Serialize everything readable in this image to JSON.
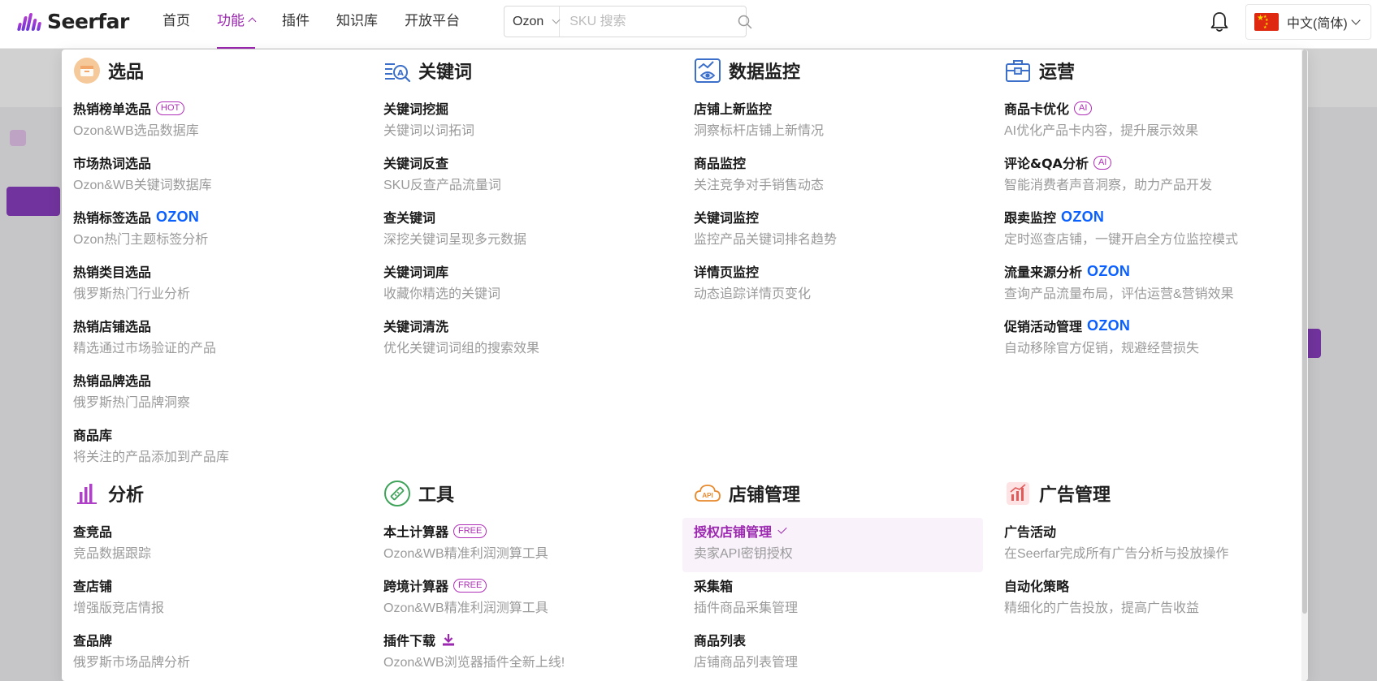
{
  "brand": {
    "name": "Seerfar"
  },
  "nav": {
    "items": [
      {
        "label": "首页",
        "active": false
      },
      {
        "label": "功能",
        "active": true
      },
      {
        "label": "插件",
        "active": false
      },
      {
        "label": "知识库",
        "active": false
      },
      {
        "label": "开放平台",
        "active": false
      }
    ]
  },
  "search": {
    "platform": "Ozon",
    "placeholder": "SKU 搜索"
  },
  "language": {
    "label": "中文(简体)"
  },
  "colors": {
    "accent": "#9c27b0",
    "ozon": "#0a5fff",
    "badge": "#b02fb8"
  },
  "menu": {
    "selection": {
      "title": "选品",
      "icon": "product-box-icon",
      "items": [
        {
          "title": "热销榜单选品",
          "badge": "HOT",
          "desc": "Ozon&WB选品数据库"
        },
        {
          "title": "市场热词选品",
          "desc": "Ozon&WB关键词数据库"
        },
        {
          "title": "热销标签选品",
          "tag": "OZON",
          "desc": "Ozon热门主题标签分析"
        },
        {
          "title": "热销类目选品",
          "desc": "俄罗斯热门行业分析"
        },
        {
          "title": "热销店铺选品",
          "desc": "精选通过市场验证的产品"
        },
        {
          "title": "热销品牌选品",
          "desc": "俄罗斯热门品牌洞察"
        },
        {
          "title": "商品库",
          "desc": "将关注的产品添加到产品库"
        }
      ]
    },
    "keywords": {
      "title": "关键词",
      "icon": "keyword-search-icon",
      "items": [
        {
          "title": "关键词挖掘",
          "desc": "关键词以词拓词"
        },
        {
          "title": "关键词反查",
          "desc": "SKU反查产品流量词"
        },
        {
          "title": "查关键词",
          "desc": "深挖关键词呈现多元数据"
        },
        {
          "title": "关键词词库",
          "desc": "收藏你精选的关键词"
        },
        {
          "title": "关键词清洗",
          "desc": "优化关键词词组的搜索效果"
        }
      ]
    },
    "monitoring": {
      "title": "数据监控",
      "icon": "monitor-eye-icon",
      "items": [
        {
          "title": "店铺上新监控",
          "desc": "洞察标杆店铺上新情况"
        },
        {
          "title": "商品监控",
          "desc": "关注竞争对手销售动态"
        },
        {
          "title": "关键词监控",
          "desc": "监控产品关键词排名趋势"
        },
        {
          "title": "详情页监控",
          "desc": "动态追踪详情页变化"
        }
      ]
    },
    "operations": {
      "title": "运营",
      "icon": "toolbox-icon",
      "items": [
        {
          "title": "商品卡优化",
          "badge": "AI",
          "desc": "AI优化产品卡内容，提升展示效果"
        },
        {
          "title": "评论&QA分析",
          "badge": "AI",
          "desc": "智能消费者声音洞察，助力产品开发"
        },
        {
          "title": "跟卖监控",
          "tag": "OZON",
          "desc": "定时巡查店铺，一键开启全方位监控模式"
        },
        {
          "title": "流量来源分析",
          "tag": "OZON",
          "desc": "查询产品流量布局，评估运营&营销效果"
        },
        {
          "title": "促销活动管理",
          "tag": "OZON",
          "desc": "自动移除官方促销，规避经营损失"
        }
      ]
    },
    "analysis": {
      "title": "分析",
      "icon": "bar-chart-icon",
      "items": [
        {
          "title": "查竞品",
          "desc": "竞品数据跟踪"
        },
        {
          "title": "查店铺",
          "desc": "增强版竞店情报"
        },
        {
          "title": "查品牌",
          "desc": "俄罗斯市场品牌分析"
        }
      ]
    },
    "tools": {
      "title": "工具",
      "icon": "ruler-tool-icon",
      "items": [
        {
          "title": "本土计算器",
          "badge": "FREE",
          "desc": "Ozon&WB精准利润测算工具"
        },
        {
          "title": "跨境计算器",
          "badge": "FREE",
          "desc": "Ozon&WB精准利润测算工具"
        },
        {
          "title": "插件下载",
          "desc": "Ozon&WB浏览器插件全新上线!"
        }
      ]
    },
    "store": {
      "title": "店铺管理",
      "icon": "api-cloud-icon",
      "items": [
        {
          "title": "授权店铺管理",
          "desc": "卖家API密钥授权",
          "selected": true
        },
        {
          "title": "采集箱",
          "desc": "插件商品采集管理"
        },
        {
          "title": "商品列表",
          "desc": "店铺商品列表管理"
        }
      ]
    },
    "ads": {
      "title": "广告管理",
      "icon": "ad-chart-icon",
      "items": [
        {
          "title": "广告活动",
          "desc": "在Seerfar完成所有广告分析与投放操作"
        },
        {
          "title": "自动化策略",
          "desc": "精细化的广告投放，提高广告收益"
        }
      ]
    }
  }
}
